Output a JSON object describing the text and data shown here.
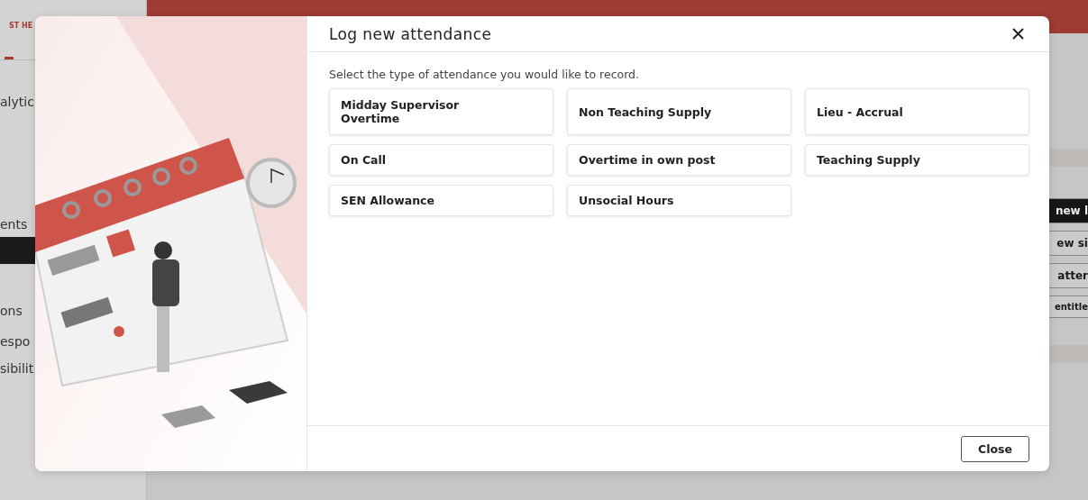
{
  "background": {
    "logo": "ST HE",
    "sidebar_items": [
      {
        "label": "alytic"
      },
      {
        "label": "ents"
      },
      {
        "label": "ons"
      },
      {
        "label": "espo"
      },
      {
        "label": "sibilit"
      }
    ],
    "action_buttons": [
      {
        "label": "new l",
        "kind": "primary"
      },
      {
        "label": "ew si",
        "kind": "outline"
      },
      {
        "label": "atter",
        "kind": "outline"
      },
      {
        "label": "entitle",
        "kind": "outline"
      }
    ]
  },
  "dialog": {
    "title": "Log new attendance",
    "instruction": "Select the type of attendance you would like to record.",
    "options": [
      {
        "label": "Midday Supervisor Overtime"
      },
      {
        "label": "Non Teaching Supply"
      },
      {
        "label": "Lieu - Accrual"
      },
      {
        "label": "On Call"
      },
      {
        "label": "Overtime in own post"
      },
      {
        "label": "Teaching Supply"
      },
      {
        "label": "SEN Allowance"
      },
      {
        "label": "Unsocial Hours"
      }
    ],
    "buttons": [
      "Close"
    ]
  }
}
